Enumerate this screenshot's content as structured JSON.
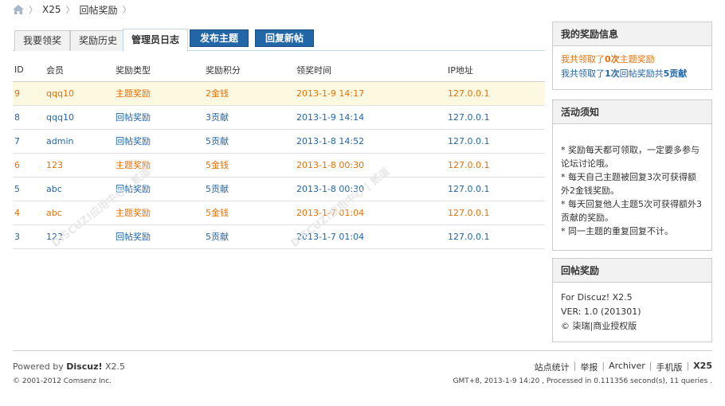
{
  "breadcrumb": {
    "items": [
      "X25",
      "回帖奖励"
    ]
  },
  "tabs": [
    {
      "label": "我要领奖"
    },
    {
      "label": "奖励历史"
    },
    {
      "label": "管理员日志"
    }
  ],
  "actions": {
    "new_topic": "发布主题",
    "reply_post": "回复新帖"
  },
  "table": {
    "headers": [
      "ID",
      "会员",
      "奖励类型",
      "奖励积分",
      "领奖时间",
      "IP地址"
    ],
    "rows": [
      {
        "id": "9",
        "member": "qqq10",
        "type": "主题奖励",
        "points": "2金钱",
        "time": "2013-1-9 14:17",
        "ip": "127.0.0.1",
        "color": "orange"
      },
      {
        "id": "8",
        "member": "qqq10",
        "type": "回帖奖励",
        "points": "3贡献",
        "time": "2013-1-9 14:14",
        "ip": "127.0.0.1",
        "color": "blue"
      },
      {
        "id": "7",
        "member": "admin",
        "type": "回帖奖励",
        "points": "5贡献",
        "time": "2013-1-8 14:52",
        "ip": "127.0.0.1",
        "color": "blue"
      },
      {
        "id": "6",
        "member": "123",
        "type": "主题奖励",
        "points": "5金钱",
        "time": "2013-1-8 00:30",
        "ip": "127.0.0.1",
        "color": "orange"
      },
      {
        "id": "5",
        "member": "abc",
        "type": "回帖奖励",
        "points": "5贡献",
        "time": "2013-1-8 00:30",
        "ip": "127.0.0.1",
        "color": "blue"
      },
      {
        "id": "4",
        "member": "abc",
        "type": "主题奖励",
        "points": "5金钱",
        "time": "2013-1-7 01:04",
        "ip": "127.0.0.1",
        "color": "orange"
      },
      {
        "id": "3",
        "member": "123",
        "type": "回帖奖励",
        "points": "5贡献",
        "time": "2013-1-7 01:04",
        "ip": "127.0.0.1",
        "color": "blue"
      }
    ]
  },
  "sidebar": {
    "my_reward": {
      "title": "我的奖励信息",
      "line1_pre": "我共领取了",
      "line1_count": "0次",
      "line1_post": "主题奖励",
      "line2_pre": "我共领取了",
      "line2_count": "1次",
      "line2_mid": "回帖奖励共",
      "line2_amount": "5贡献"
    },
    "notice": {
      "title": "活动须知",
      "items": [
        "* 奖励每天都可领取，一定要多参与论坛讨论哦。",
        "* 每天自己主题被回复3次可获得额外2金钱奖励。",
        "* 每天回复他人主题5次可获得额外3贡献的奖励。",
        "* 同一主题的重复回复不计。"
      ]
    },
    "plugin": {
      "title": "回帖奖励",
      "line1": "For Discuz! X2.5",
      "line2": "VER: 1.0 (201301)",
      "line3": "© 柒瑞|商业授权版"
    }
  },
  "watermark": {
    "text": "DISCUZ!应用中心 | 贰道",
    "sub": "addon.discuz.com"
  },
  "footer": {
    "powered_pre": "Powered by",
    "powered_brand": "Discuz!",
    "powered_ver": "X2.5",
    "copyright": "© 2001-2012 Comsenz Inc.",
    "links": [
      "站点统计",
      "举报",
      "Archiver",
      "手机版"
    ],
    "site": "X25",
    "gmt": "GMT+8, 2013-1-9 14:20 , Processed in 0.111356 second(s), 11 queries ."
  },
  "colors": {
    "orange": "#e6700a",
    "blue": "#2366a8",
    "button": "#2366a8",
    "highlight": "#fdf9e0"
  }
}
